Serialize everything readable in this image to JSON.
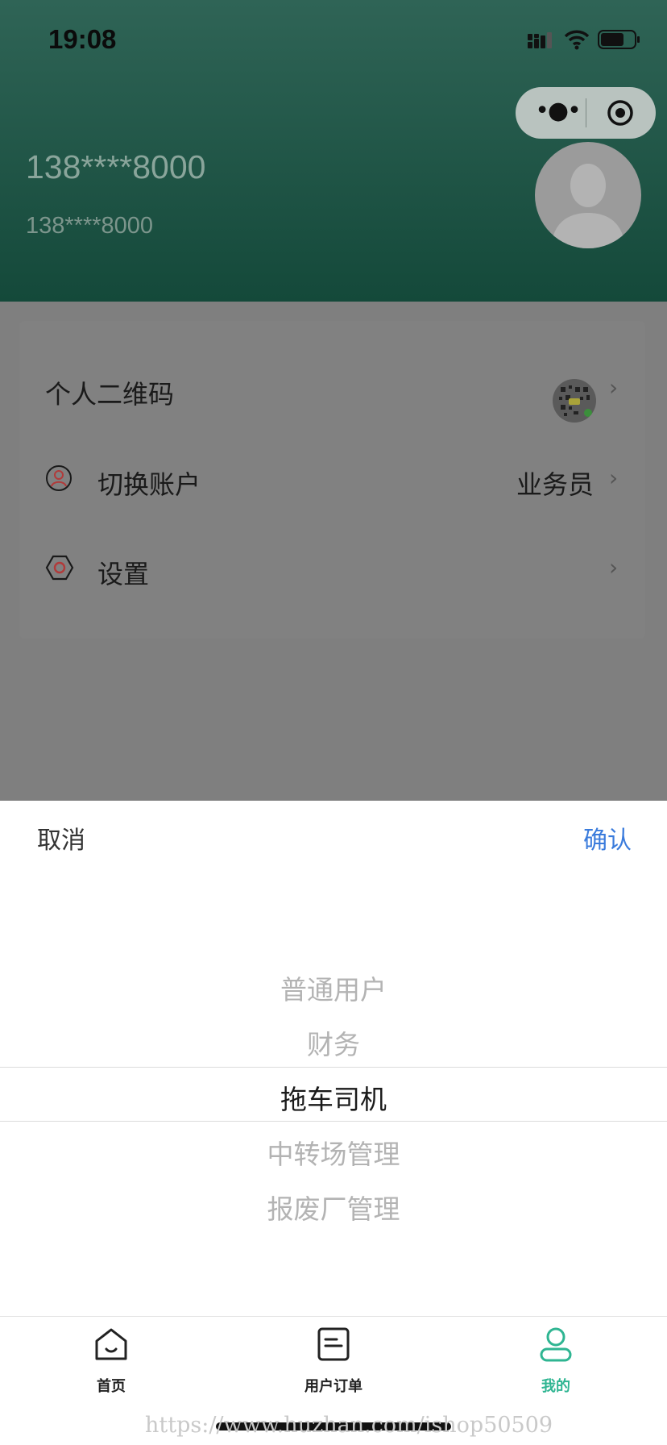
{
  "status_bar": {
    "time": "19:08"
  },
  "profile": {
    "name": "138****8000",
    "phone": "138****8000"
  },
  "menu": [
    {
      "label": "个人二维码",
      "icon": "qr-code-thumbnail",
      "value": ""
    },
    {
      "label": "切换账户",
      "icon": "user-circle-icon",
      "value": "业务员"
    },
    {
      "label": "设置",
      "icon": "hexagon-settings-icon",
      "value": ""
    }
  ],
  "picker": {
    "cancel_label": "取消",
    "confirm_label": "确认",
    "options": [
      "普通用户",
      "财务",
      "拖车司机",
      "中转场管理",
      "报废厂管理"
    ],
    "selected": "拖车司机"
  },
  "tabbar": {
    "tabs": [
      {
        "label": "首页",
        "icon": "home-icon",
        "active": false
      },
      {
        "label": "用户订单",
        "icon": "order-icon",
        "active": false
      },
      {
        "label": "我的",
        "icon": "profile-icon",
        "active": true
      }
    ],
    "active_color": "#2fb592"
  },
  "watermark": "https://www.huzhan.com/ishop50509",
  "colors": {
    "header": "#1f5446",
    "confirm": "#3a7bdc",
    "overlay": "#7f7f7f"
  }
}
